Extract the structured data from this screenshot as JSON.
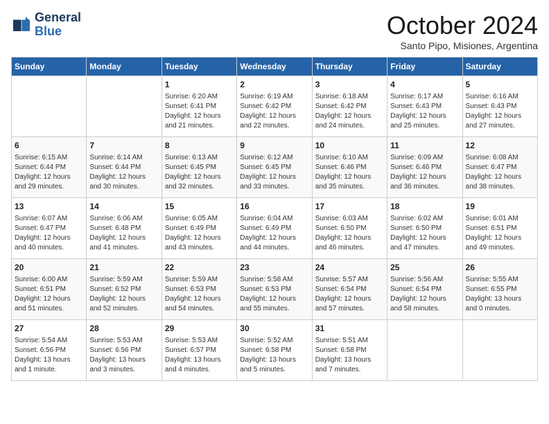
{
  "logo": {
    "line1": "General",
    "line2": "Blue"
  },
  "title": "October 2024",
  "subtitle": "Santo Pipo, Misiones, Argentina",
  "days_of_week": [
    "Sunday",
    "Monday",
    "Tuesday",
    "Wednesday",
    "Thursday",
    "Friday",
    "Saturday"
  ],
  "weeks": [
    [
      {
        "day": "",
        "info": ""
      },
      {
        "day": "",
        "info": ""
      },
      {
        "day": "1",
        "info": "Sunrise: 6:20 AM\nSunset: 6:41 PM\nDaylight: 12 hours and 21 minutes."
      },
      {
        "day": "2",
        "info": "Sunrise: 6:19 AM\nSunset: 6:42 PM\nDaylight: 12 hours and 22 minutes."
      },
      {
        "day": "3",
        "info": "Sunrise: 6:18 AM\nSunset: 6:42 PM\nDaylight: 12 hours and 24 minutes."
      },
      {
        "day": "4",
        "info": "Sunrise: 6:17 AM\nSunset: 6:43 PM\nDaylight: 12 hours and 25 minutes."
      },
      {
        "day": "5",
        "info": "Sunrise: 6:16 AM\nSunset: 6:43 PM\nDaylight: 12 hours and 27 minutes."
      }
    ],
    [
      {
        "day": "6",
        "info": "Sunrise: 6:15 AM\nSunset: 6:44 PM\nDaylight: 12 hours and 29 minutes."
      },
      {
        "day": "7",
        "info": "Sunrise: 6:14 AM\nSunset: 6:44 PM\nDaylight: 12 hours and 30 minutes."
      },
      {
        "day": "8",
        "info": "Sunrise: 6:13 AM\nSunset: 6:45 PM\nDaylight: 12 hours and 32 minutes."
      },
      {
        "day": "9",
        "info": "Sunrise: 6:12 AM\nSunset: 6:45 PM\nDaylight: 12 hours and 33 minutes."
      },
      {
        "day": "10",
        "info": "Sunrise: 6:10 AM\nSunset: 6:46 PM\nDaylight: 12 hours and 35 minutes."
      },
      {
        "day": "11",
        "info": "Sunrise: 6:09 AM\nSunset: 6:46 PM\nDaylight: 12 hours and 36 minutes."
      },
      {
        "day": "12",
        "info": "Sunrise: 6:08 AM\nSunset: 6:47 PM\nDaylight: 12 hours and 38 minutes."
      }
    ],
    [
      {
        "day": "13",
        "info": "Sunrise: 6:07 AM\nSunset: 6:47 PM\nDaylight: 12 hours and 40 minutes."
      },
      {
        "day": "14",
        "info": "Sunrise: 6:06 AM\nSunset: 6:48 PM\nDaylight: 12 hours and 41 minutes."
      },
      {
        "day": "15",
        "info": "Sunrise: 6:05 AM\nSunset: 6:49 PM\nDaylight: 12 hours and 43 minutes."
      },
      {
        "day": "16",
        "info": "Sunrise: 6:04 AM\nSunset: 6:49 PM\nDaylight: 12 hours and 44 minutes."
      },
      {
        "day": "17",
        "info": "Sunrise: 6:03 AM\nSunset: 6:50 PM\nDaylight: 12 hours and 46 minutes."
      },
      {
        "day": "18",
        "info": "Sunrise: 6:02 AM\nSunset: 6:50 PM\nDaylight: 12 hours and 47 minutes."
      },
      {
        "day": "19",
        "info": "Sunrise: 6:01 AM\nSunset: 6:51 PM\nDaylight: 12 hours and 49 minutes."
      }
    ],
    [
      {
        "day": "20",
        "info": "Sunrise: 6:00 AM\nSunset: 6:51 PM\nDaylight: 12 hours and 51 minutes."
      },
      {
        "day": "21",
        "info": "Sunrise: 5:59 AM\nSunset: 6:52 PM\nDaylight: 12 hours and 52 minutes."
      },
      {
        "day": "22",
        "info": "Sunrise: 5:59 AM\nSunset: 6:53 PM\nDaylight: 12 hours and 54 minutes."
      },
      {
        "day": "23",
        "info": "Sunrise: 5:58 AM\nSunset: 6:53 PM\nDaylight: 12 hours and 55 minutes."
      },
      {
        "day": "24",
        "info": "Sunrise: 5:57 AM\nSunset: 6:54 PM\nDaylight: 12 hours and 57 minutes."
      },
      {
        "day": "25",
        "info": "Sunrise: 5:56 AM\nSunset: 6:54 PM\nDaylight: 12 hours and 58 minutes."
      },
      {
        "day": "26",
        "info": "Sunrise: 5:55 AM\nSunset: 6:55 PM\nDaylight: 13 hours and 0 minutes."
      }
    ],
    [
      {
        "day": "27",
        "info": "Sunrise: 5:54 AM\nSunset: 6:56 PM\nDaylight: 13 hours and 1 minute."
      },
      {
        "day": "28",
        "info": "Sunrise: 5:53 AM\nSunset: 6:56 PM\nDaylight: 13 hours and 3 minutes."
      },
      {
        "day": "29",
        "info": "Sunrise: 5:53 AM\nSunset: 6:57 PM\nDaylight: 13 hours and 4 minutes."
      },
      {
        "day": "30",
        "info": "Sunrise: 5:52 AM\nSunset: 6:58 PM\nDaylight: 13 hours and 5 minutes."
      },
      {
        "day": "31",
        "info": "Sunrise: 5:51 AM\nSunset: 6:58 PM\nDaylight: 13 hours and 7 minutes."
      },
      {
        "day": "",
        "info": ""
      },
      {
        "day": "",
        "info": ""
      }
    ]
  ]
}
